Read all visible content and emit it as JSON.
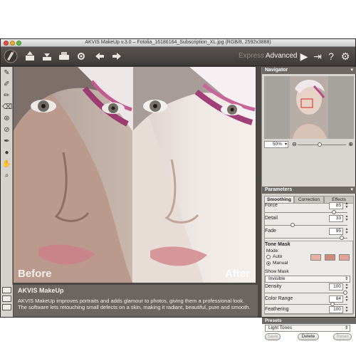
{
  "window": {
    "title": "AKVIS MakeUp v.3.0 – Fotolia_16186164_Subscription_XL.jpg (RGB/8, 2592x3888)"
  },
  "toolbar": {
    "modes": {
      "express": "Express",
      "advanced": "Advanced"
    },
    "buttons": [
      "open-icon",
      "save-icon",
      "print-icon",
      "share-icon",
      "undo-icon",
      "redo-icon"
    ],
    "right_buttons": [
      "run-icon",
      "settings-icon",
      "help-icon",
      "preferences-icon"
    ]
  },
  "canvas": {
    "before_label": "Before",
    "after_label": "After"
  },
  "info": {
    "title": "AKVIS MakeUp",
    "text": "AKVIS MakeUp improves portraits and adds glamour to photos, giving them a professional look. The software lets retouching small defects on a skin, making it radiant, beautiful, pure and smooth."
  },
  "navigator": {
    "title": "Navigator",
    "zoom": "50%",
    "zoom_fraction": 0.45
  },
  "parameters": {
    "title": "Parameters",
    "tabs": [
      "Smoothing",
      "Correction",
      "Effects"
    ],
    "active_tab": "Smoothing",
    "sliders": [
      {
        "label": "Force",
        "value": "85",
        "fraction": 0.85
      },
      {
        "label": "Detail",
        "value": "33",
        "fraction": 0.33
      },
      {
        "label": "Fade",
        "value": "95",
        "fraction": 0.95
      }
    ],
    "tone_mask": {
      "title": "Tone Mask",
      "mode_label": "Mode:",
      "auto_label": "Auto",
      "manual_label": "Manual",
      "selected_mode": "Manual",
      "swatches": [
        "#e9b1a6",
        "#cf8a7f",
        "#e3a397"
      ],
      "show_mask_label": "Show Mask",
      "show_mask_value": "Invisible",
      "density": {
        "label": "Density",
        "value": "100",
        "fraction": 1.0
      },
      "color_range": {
        "label": "Color Range",
        "value": "84",
        "fraction": 0.84
      },
      "feathering": {
        "label": "Feathering",
        "value": "100",
        "fraction": 1.0
      }
    }
  },
  "presets": {
    "title": "Presets",
    "selected": "Light Tones",
    "buttons": {
      "save": "Save",
      "delete": "Delete",
      "reset": "Reset"
    }
  }
}
